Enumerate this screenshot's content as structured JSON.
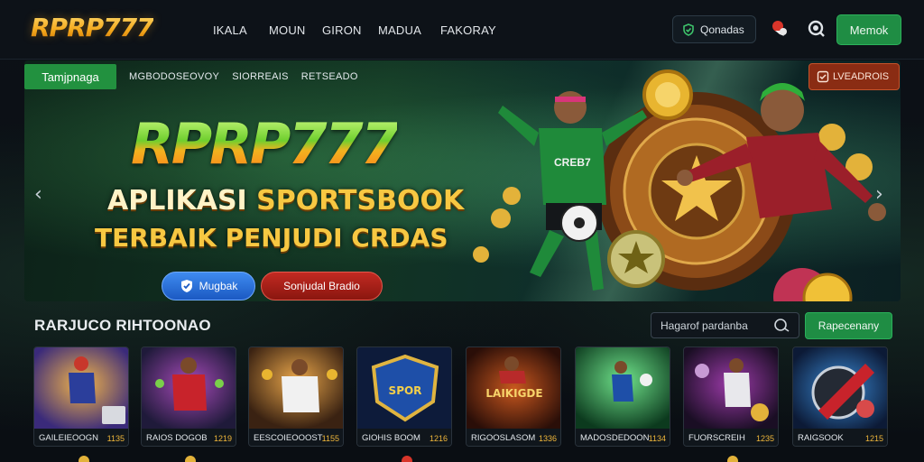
{
  "header": {
    "logo": "RPRP777",
    "nav": [
      "IKALA",
      "MOUN",
      "GIRON",
      "MADUA",
      "FAKORAY"
    ],
    "pill_label": "Qonadas",
    "cta_label": "Memok"
  },
  "hero": {
    "active_tab": "Tamjpnaga",
    "tabs": [
      "MGBODOSEOVOY",
      "SIORREAIS",
      "RETSEADO"
    ],
    "badge": "LVEADROIS",
    "logo": "RPRP777",
    "line1_a": "APLIKASI",
    "line1_b": "SPORTSBOOK",
    "line2": "TERBAIK PENJUDI CRDAS",
    "btn_primary": "Mugbak",
    "btn_secondary": "Sonjudal Bradio",
    "jersey": "CREB7",
    "arrow_left": "‹",
    "arrow_right": "›"
  },
  "section": {
    "title": "RARJUCO RIHTOONAO",
    "search_placeholder": "Hagarof pardanba",
    "filter_label": "Rapecenany"
  },
  "games": [
    {
      "name": "GAILEIEOOGN",
      "count": "1135"
    },
    {
      "name": "RAIOS DOGOB",
      "count": "1219"
    },
    {
      "name": "EESCOIEOOOST",
      "count": "1155"
    },
    {
      "name": "GIOHIS BOOM",
      "count": "1216"
    },
    {
      "name": "RIGOOSLASOM",
      "count": "1336"
    },
    {
      "name": "MADOSDEDOON",
      "count": "1134"
    },
    {
      "name": "FUORSCREIH",
      "count": "1235"
    },
    {
      "name": "RAIGSOOK",
      "count": "1215"
    }
  ],
  "game_art_text": {
    "card4": "SPOR",
    "card5": "LAIKIGDE"
  },
  "colors": {
    "accent_green": "#1f8d44",
    "gold": "#f1a81d",
    "red_button": "#c22a22",
    "blue_button": "#1b59c2"
  }
}
